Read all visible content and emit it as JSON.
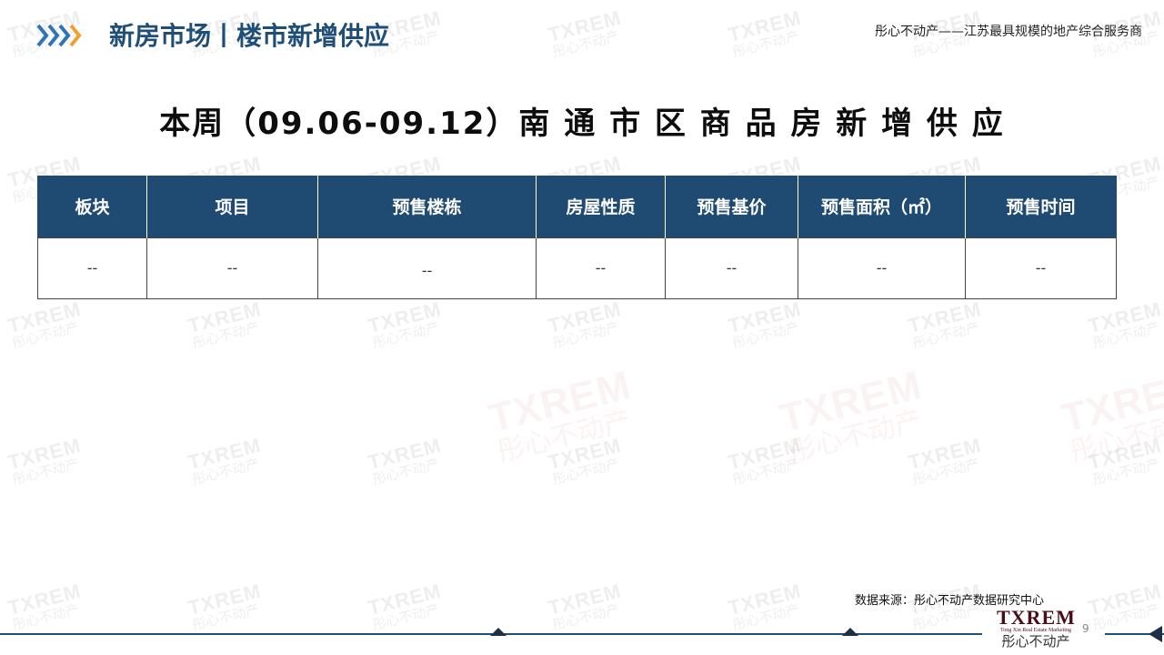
{
  "header": {
    "section_title": "新房市场丨楼市新增供应",
    "tagline": "彤心不动产——江苏最具规模的地产综合服务商"
  },
  "headline": "本周（09.06-09.12）南 通 市 区 商 品 房 新 增 供 应",
  "table": {
    "columns": [
      "板块",
      "项目",
      "预售楼栋",
      "房屋性质",
      "预售基价",
      "预售面积（㎡）",
      "预售时间"
    ],
    "rows": [
      [
        "--",
        "--",
        "--",
        "--",
        "--",
        "--",
        "--"
      ]
    ]
  },
  "watermark": {
    "en": "TXREM",
    "cn": "彤心不动产"
  },
  "footer": {
    "source_note": "数据来源：彤心不动产数据研究中心",
    "logo_en": "TXREM",
    "logo_sub": "Tong Xin Real Estate Marketing",
    "logo_cn": "彤心不动产",
    "page_number": "9"
  },
  "colors": {
    "brand_blue": "#1f4e79",
    "table_header": "#1f4a72",
    "chevron_blue": "#2e75b6",
    "chevron_orange": "#f0a030",
    "logo_maroon": "#4a0e18"
  }
}
